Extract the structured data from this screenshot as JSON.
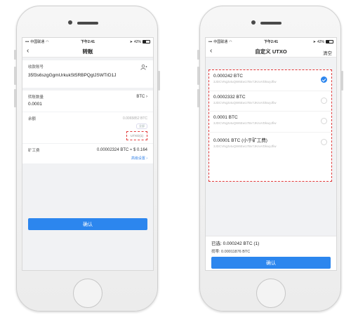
{
  "colors": {
    "accent": "#2c86ee",
    "highlight_border": "#e23a3a"
  },
  "left": {
    "status": {
      "carrier": "中国联通",
      "time": "下午2:41",
      "battery": "42%",
      "battery_level": 0.42
    },
    "nav": {
      "title": "转账",
      "back_icon": "chevron-left-icon"
    },
    "recipient": {
      "label": "收款账号",
      "address": "35f3s6szgGgmUrkukSt5RBPQgtJSWTrD1J",
      "icon": "contact-icon"
    },
    "amount": {
      "label": "转账数量",
      "unit": "BTC",
      "value": "0.0001"
    },
    "balance": {
      "label": "余额",
      "value": "0.0065852 BTC",
      "all_label": "全部",
      "utxo_label": "UTXO(1)"
    },
    "fee": {
      "label": "矿工费",
      "value": "0.00002324 BTC ≈ $ 0.164",
      "advanced": "高级设置"
    },
    "confirm": "确认"
  },
  "right": {
    "status": {
      "carrier": "中国联通",
      "time": "下午2:41",
      "battery": "42%",
      "battery_level": 0.42
    },
    "nav": {
      "title": "自定义 UTXO",
      "back_icon": "chevron-left-icon",
      "action": "清空"
    },
    "utxos": [
      {
        "amount": "0.000242 BTC",
        "address": "3JDCVNg3vtuQW6Ew17Bv7JKnvVDkwyJfiw",
        "checked": true
      },
      {
        "amount": "0.0002332 BTC",
        "address": "3JDCVNg3vtuQW6Ew17Bv7JKnvVDkwyJfiw",
        "checked": false
      },
      {
        "amount": "0.0001 BTC",
        "address": "3JDCVNg3vtuQW6Ew17Bv7JKnvVDkwyJfiw",
        "checked": false
      },
      {
        "amount": "0.00001 BTC (小于矿工费)",
        "address": "3JDCVNg3vtuQW6Ew17Bv7JKnvVDkwyJfiw",
        "checked": false
      }
    ],
    "summary": {
      "selected": "已选: 0.000242 BTC (1)",
      "change": "找零: 0.00011876 BTC"
    },
    "confirm": "确认"
  }
}
